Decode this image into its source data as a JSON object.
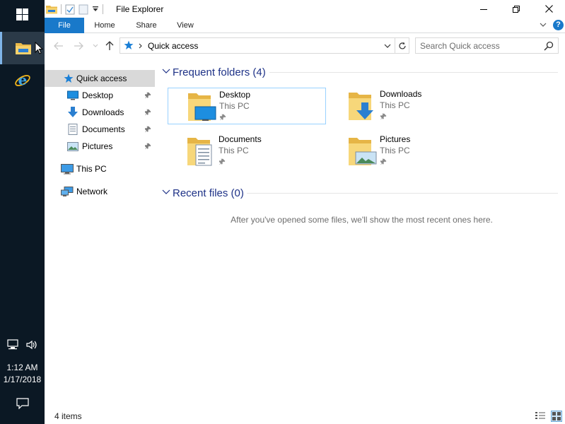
{
  "window": {
    "title": "File Explorer"
  },
  "ribbon": {
    "tabs": [
      {
        "label": "File"
      },
      {
        "label": "Home"
      },
      {
        "label": "Share"
      },
      {
        "label": "View"
      }
    ],
    "help_label": "?"
  },
  "address": {
    "path": "Quick access"
  },
  "search": {
    "placeholder": "Search Quick access"
  },
  "nav": {
    "items": [
      {
        "label": "Quick access"
      },
      {
        "label": "Desktop",
        "pinned": true
      },
      {
        "label": "Downloads",
        "pinned": true
      },
      {
        "label": "Documents",
        "pinned": true
      },
      {
        "label": "Pictures",
        "pinned": true
      },
      {
        "label": "This PC"
      },
      {
        "label": "Network"
      }
    ]
  },
  "groups": {
    "frequent": {
      "title": "Frequent folders (4)",
      "folders": [
        {
          "name": "Desktop",
          "location": "This PC",
          "icon": "folder-desktop-icon"
        },
        {
          "name": "Downloads",
          "location": "This PC",
          "icon": "folder-downloads-icon"
        },
        {
          "name": "Documents",
          "location": "This PC",
          "icon": "folder-documents-icon"
        },
        {
          "name": "Pictures",
          "location": "This PC",
          "icon": "folder-pictures-icon"
        }
      ]
    },
    "recent": {
      "title": "Recent files (0)",
      "empty_message": "After you've opened some files, we'll show the most recent ones here."
    }
  },
  "status": {
    "items_text": "4 items"
  },
  "taskbar": {
    "time": "1:12 AM",
    "date": "1/17/2018"
  },
  "colors": {
    "accent": "#1979ca",
    "taskbar": "#0b1824",
    "group_title": "#1e3287",
    "selection_border": "#99d1ff",
    "nav_selected": "#d9d9d9"
  }
}
